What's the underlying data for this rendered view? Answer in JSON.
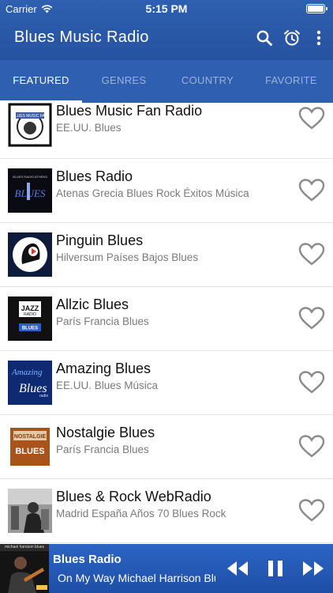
{
  "status_bar": {
    "carrier": "Carrier",
    "time": "5:15 PM"
  },
  "header": {
    "title": "Blues Music Radio"
  },
  "nav_icons": [
    "search-icon",
    "alarm-clock-icon",
    "more-vertical-icon"
  ],
  "tabs": [
    {
      "label": "FEATURED",
      "active": true
    },
    {
      "label": "GENRES",
      "active": false
    },
    {
      "label": "COUNTRY",
      "active": false
    },
    {
      "label": "FAVORITE",
      "active": false
    }
  ],
  "stations": [
    {
      "name": "Blues Music Fan Radio",
      "subtitle": "EE.UU. Blues",
      "logo_text": "BLUES MUSIC FAN"
    },
    {
      "name": "Blues Radio",
      "subtitle": "Atenas Grecia Blues Rock Éxitos Música",
      "logo_text": "BLUES"
    },
    {
      "name": " Pinguin Blues",
      "subtitle": "Hilversum Países Bajos Blues",
      "logo_text": ""
    },
    {
      "name": "Allzic Blues",
      "subtitle": "París Francia Blues",
      "logo_text": "JAZZ RADIO BLUES"
    },
    {
      "name": "Amazing Blues",
      "subtitle": "EE.UU. Blues Música",
      "logo_text": "Amazing Blues radio"
    },
    {
      "name": "Nostalgie Blues",
      "subtitle": "París Francia Blues",
      "logo_text": "NOSTALGIE BLUES"
    },
    {
      "name": "Blues & Rock WebRadio",
      "subtitle": "Madrid España Años 70 Blues Rock",
      "logo_text": ""
    }
  ],
  "player": {
    "art_caption": "michael harrison blues",
    "title": "Blues Radio",
    "now_playing": "On My Way   Michael Harrison Blues"
  },
  "colors": {
    "header": "#2f5fb0",
    "player": "#2458b8",
    "heart": "#8a8a8a"
  }
}
